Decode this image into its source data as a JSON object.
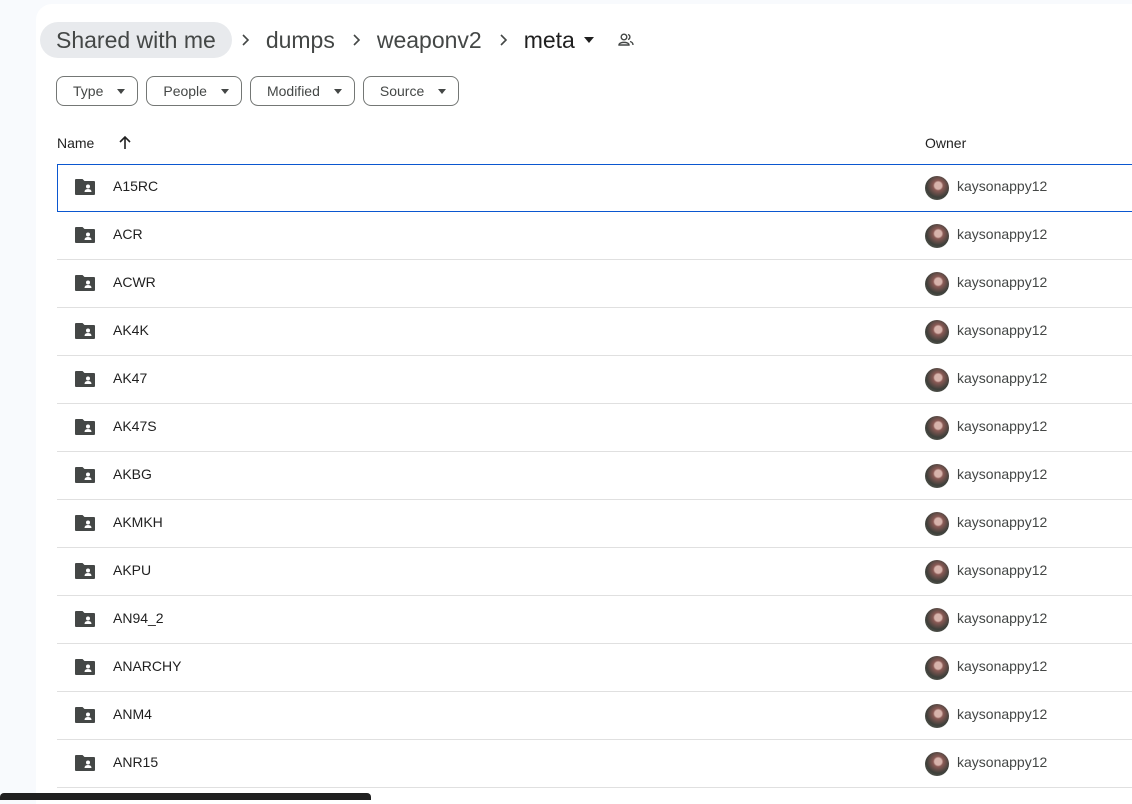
{
  "breadcrumb": {
    "root": "Shared with me",
    "items": [
      "dumps",
      "weaponv2"
    ],
    "current": "meta"
  },
  "filters": [
    "Type",
    "People",
    "Modified",
    "Source"
  ],
  "columns": {
    "name": "Name",
    "owner": "Owner"
  },
  "rows": [
    {
      "name": "A15RC",
      "owner": "kaysonappy12"
    },
    {
      "name": "ACR",
      "owner": "kaysonappy12"
    },
    {
      "name": "ACWR",
      "owner": "kaysonappy12"
    },
    {
      "name": "AK4K",
      "owner": "kaysonappy12"
    },
    {
      "name": "AK47",
      "owner": "kaysonappy12"
    },
    {
      "name": "AK47S",
      "owner": "kaysonappy12"
    },
    {
      "name": "AKBG",
      "owner": "kaysonappy12"
    },
    {
      "name": "AKMKH",
      "owner": "kaysonappy12"
    },
    {
      "name": "AKPU",
      "owner": "kaysonappy12"
    },
    {
      "name": "AN94_2",
      "owner": "kaysonappy12"
    },
    {
      "name": "ANARCHY",
      "owner": "kaysonappy12"
    },
    {
      "name": "ANM4",
      "owner": "kaysonappy12"
    },
    {
      "name": "ANR15",
      "owner": "kaysonappy12"
    }
  ],
  "icons": {
    "folder": "shared-folder-icon",
    "separator": "chevron-right-icon",
    "sort": "arrow-up-icon",
    "share": "people-icon",
    "dropdown": "caret-down-icon"
  },
  "colors": {
    "selected_border": "#0b57d0",
    "root_chip_bg": "#e8eaed"
  }
}
